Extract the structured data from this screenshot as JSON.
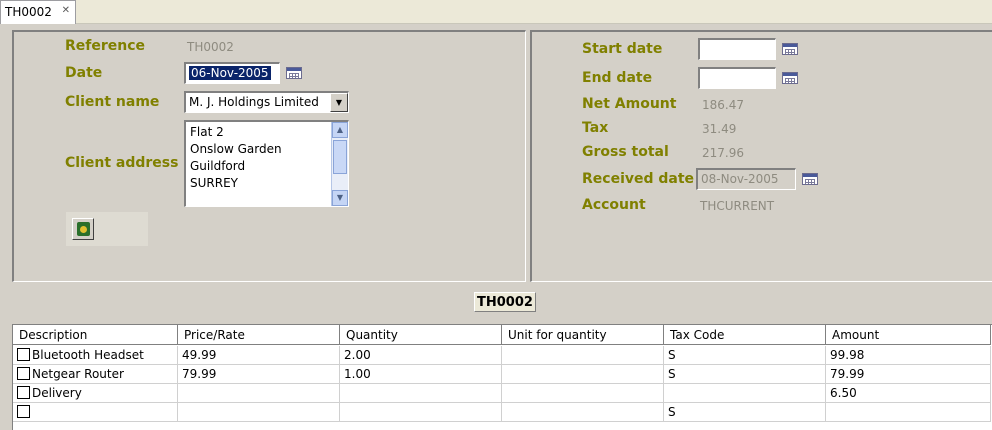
{
  "tab": {
    "title": "TH0002",
    "close_icon": "close-icon"
  },
  "left": {
    "reference_label": "Reference",
    "reference_value": "TH0002",
    "date_label": "Date",
    "date_value": "06-Nov-2005",
    "client_name_label": "Client name",
    "client_name_value": "M. J. Holdings Limited",
    "client_address_label": "Client address",
    "address_lines": [
      "Flat 2",
      "Onslow Garden",
      "Guildford",
      "SURREY"
    ]
  },
  "right": {
    "start_date_label": "Start date",
    "start_date_value": "",
    "end_date_label": "End date",
    "end_date_value": "",
    "net_amount_label": "Net Amount",
    "net_amount_value": "186.47",
    "tax_label": "Tax",
    "tax_value": "31.49",
    "gross_total_label": "Gross total",
    "gross_total_value": "217.96",
    "received_date_label": "Received date",
    "received_date_value": "08-Nov-2005",
    "account_label": "Account",
    "account_value": "THCURRENT"
  },
  "section_title": "TH0002",
  "table": {
    "headers": [
      "Description",
      "Price/Rate",
      "Quantity",
      "Unit for quantity",
      "Tax Code",
      "Amount"
    ],
    "rows": [
      {
        "description": "Bluetooth Headset",
        "price": "49.99",
        "quantity": "2.00",
        "unit": "",
        "tax_code": "S",
        "amount": "99.98"
      },
      {
        "description": "Netgear Router",
        "price": "79.99",
        "quantity": "1.00",
        "unit": "",
        "tax_code": "S",
        "amount": "79.99"
      },
      {
        "description": "Delivery",
        "price": "",
        "quantity": "",
        "unit": "",
        "tax_code": "",
        "amount": "6.50"
      },
      {
        "description": "",
        "price": "",
        "quantity": "",
        "unit": "",
        "tax_code": "S",
        "amount": ""
      }
    ]
  },
  "colors": {
    "label": "#808000",
    "value": "#8e8b80",
    "selection": "#0a246a",
    "panel": "#d4d0c8"
  }
}
